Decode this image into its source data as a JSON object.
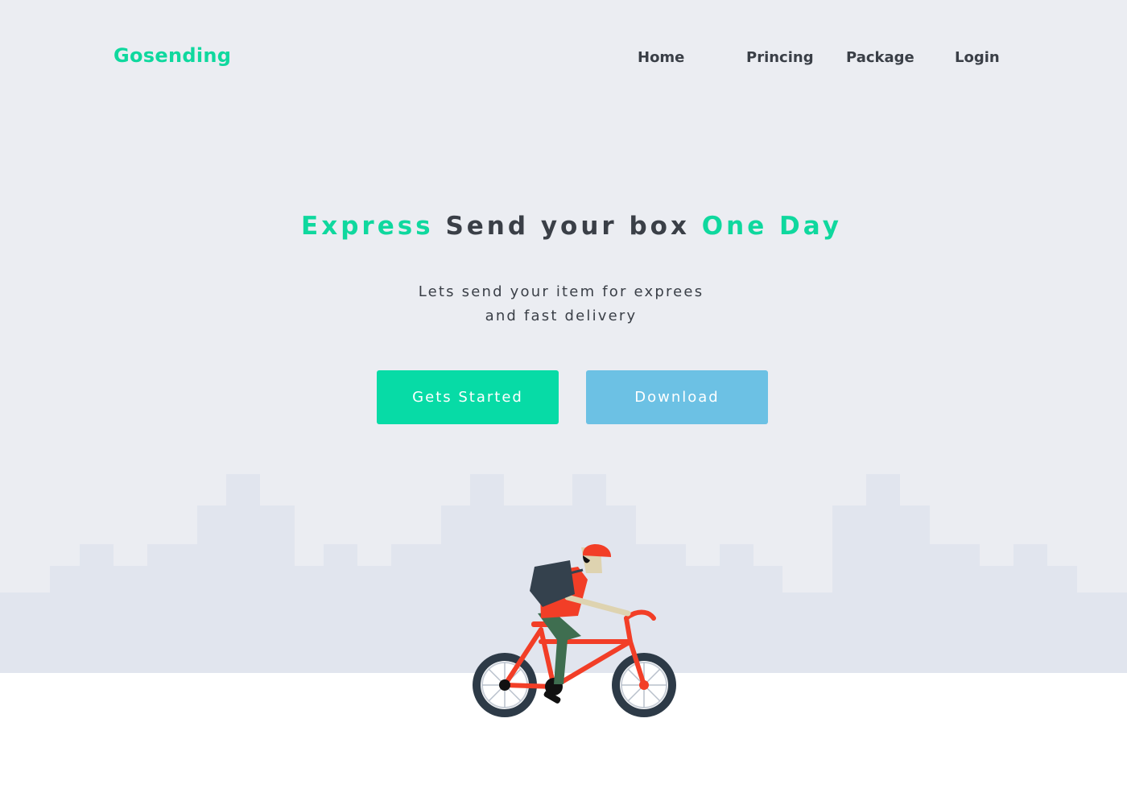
{
  "brand": {
    "name": "Gosending"
  },
  "nav": {
    "items": [
      {
        "label": "Home"
      },
      {
        "label": "Princing"
      },
      {
        "label": "Package"
      },
      {
        "label": "Login"
      }
    ]
  },
  "hero": {
    "headline": {
      "accent1": "Express",
      "middle": "Send your box",
      "accent2": "One Day"
    },
    "subtitle": {
      "line1": "Lets send your item for exprees",
      "line2": "and fast delivery"
    },
    "buttons": {
      "primary": "Gets Started",
      "secondary": "Download"
    }
  },
  "illustration": {
    "subject": "delivery-courier-on-bicycle",
    "background": "city-skyline"
  },
  "colors": {
    "accent": "#0fd89e",
    "primary_button": "#07dba6",
    "secondary_button": "#6cc1e4",
    "heading_text": "#3a3f47",
    "hero_background": "#ebedf2",
    "skyline": "#e1e5ee",
    "courier_red": "#f23e27"
  }
}
